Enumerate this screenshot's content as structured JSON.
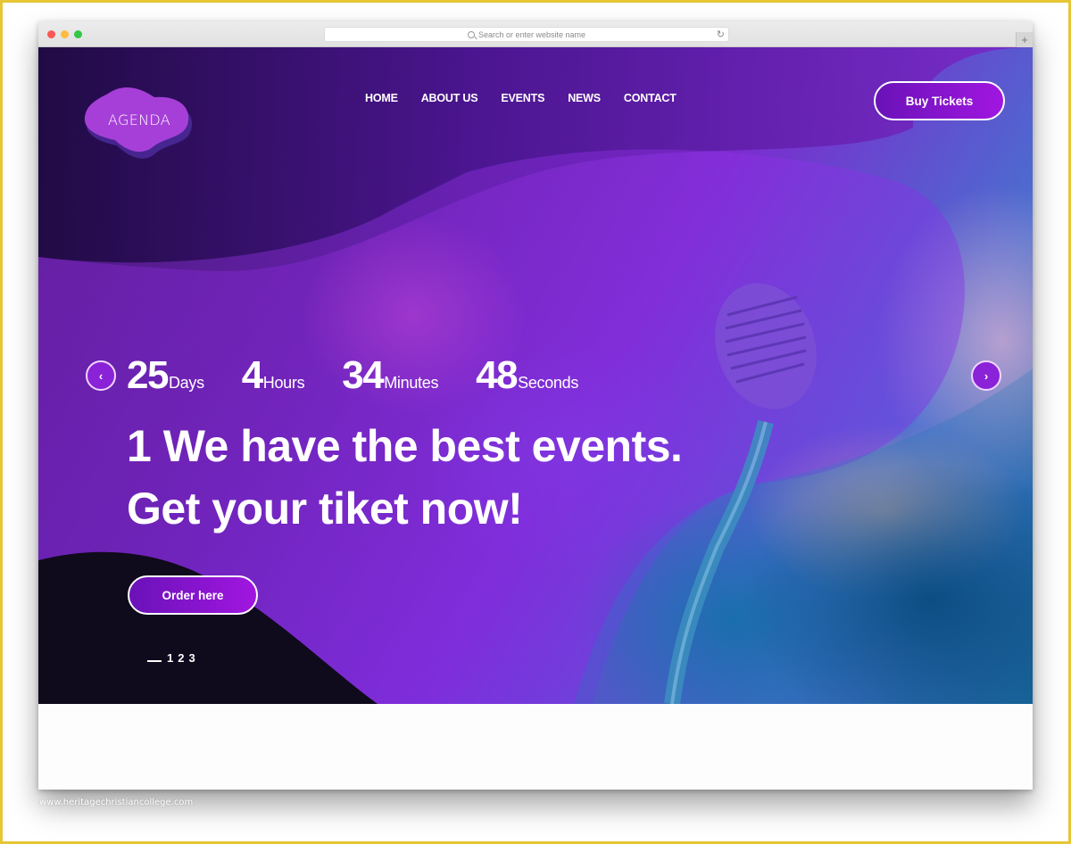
{
  "browser": {
    "url_placeholder": "Search or enter website name",
    "reload_icon": "↻",
    "new_tab_icon": "+"
  },
  "site": {
    "logo_text": "AGENDA",
    "nav": [
      {
        "label": "HOME"
      },
      {
        "label": "ABOUT US"
      },
      {
        "label": "EVENTS"
      },
      {
        "label": "NEWS"
      },
      {
        "label": "CONTACT"
      }
    ],
    "buy_button": "Buy Tickets"
  },
  "hero": {
    "prev_icon": "‹",
    "next_icon": "›",
    "countdown": [
      {
        "value": "25",
        "unit": "Days"
      },
      {
        "value": "4",
        "unit": "Hours"
      },
      {
        "value": "34",
        "unit": "Minutes"
      },
      {
        "value": "48",
        "unit": "Seconds"
      }
    ],
    "headline_line1": "1 We have the best events.",
    "headline_line2": "Get your tiket now!",
    "order_button": "Order here",
    "pager": [
      "1",
      "2",
      "3"
    ],
    "active_slide": 1
  },
  "colors": {
    "accent": "#9b16dc",
    "frame": "#e6c634"
  },
  "watermark": "www.heritagechristiancollege.com"
}
